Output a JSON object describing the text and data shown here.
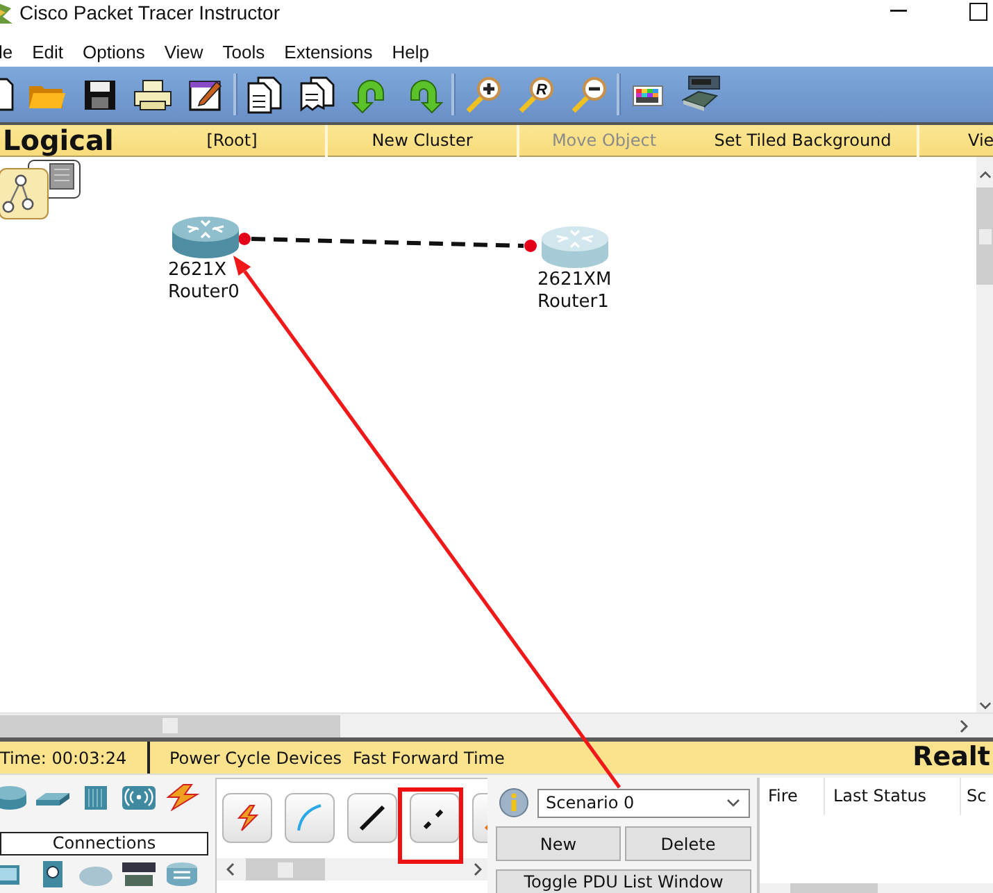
{
  "window": {
    "title": "Cisco Packet Tracer Instructor"
  },
  "menu": [
    "le",
    "Edit",
    "Options",
    "View",
    "Tools",
    "Extensions",
    "Help"
  ],
  "toolbar": {
    "zoom_reset_mark": "R"
  },
  "workspace_bar": {
    "view": "Logical",
    "items": [
      {
        "label": "[Root]",
        "disabled": false
      },
      {
        "label": "New Cluster",
        "disabled": false
      },
      {
        "label": "Move Object",
        "disabled": true
      },
      {
        "label": "Set Tiled Background",
        "disabled": false
      },
      {
        "label": "Vie",
        "disabled": false
      }
    ]
  },
  "canvas": {
    "devices": [
      {
        "model": "2621X",
        "name": "Router0",
        "highlighted": true
      },
      {
        "model": "2621XM",
        "name": "Router1",
        "highlighted": false
      }
    ],
    "links": [
      {
        "kind": "crossover",
        "connected": false
      }
    ]
  },
  "status_bar": {
    "time": "Time: 00:03:24",
    "buttons": [
      "Power Cycle Devices",
      "Fast Forward Time"
    ],
    "mode_label": "Realt"
  },
  "device_panel": {
    "category": "Connections",
    "connection_types": [
      {
        "kind": "auto",
        "annotated": false
      },
      {
        "kind": "console",
        "annotated": false
      },
      {
        "kind": "straight",
        "annotated": false
      },
      {
        "kind": "crossover",
        "annotated": true
      },
      {
        "kind": "fiber",
        "annotated": false
      }
    ]
  },
  "scenario": {
    "value": "Scenario 0",
    "buttons": [
      "New",
      "Delete",
      "Toggle PDU List Window"
    ]
  },
  "pdu_list": {
    "columns": [
      "Fire",
      "Last Status",
      "Sc"
    ]
  }
}
